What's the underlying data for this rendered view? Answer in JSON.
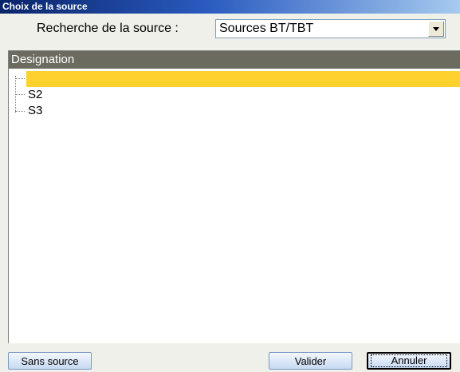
{
  "window": {
    "title": "Choix de la source"
  },
  "search": {
    "label": "Recherche de la source :",
    "selected": "Sources BT/TBT"
  },
  "tree": {
    "column_header": "Designation",
    "items": [
      {
        "label": "",
        "selected": true
      },
      {
        "label": "S2",
        "selected": false
      },
      {
        "label": "S3",
        "selected": false
      }
    ]
  },
  "buttons": {
    "no_source": "Sans source",
    "validate": "Valider",
    "cancel": "Annuler"
  },
  "colors": {
    "selection": "#ffd12e",
    "header_bg": "#6b6b5f",
    "title_bar": "#0a246a"
  },
  "icons": {
    "dropdown": "chevron-down-icon"
  }
}
